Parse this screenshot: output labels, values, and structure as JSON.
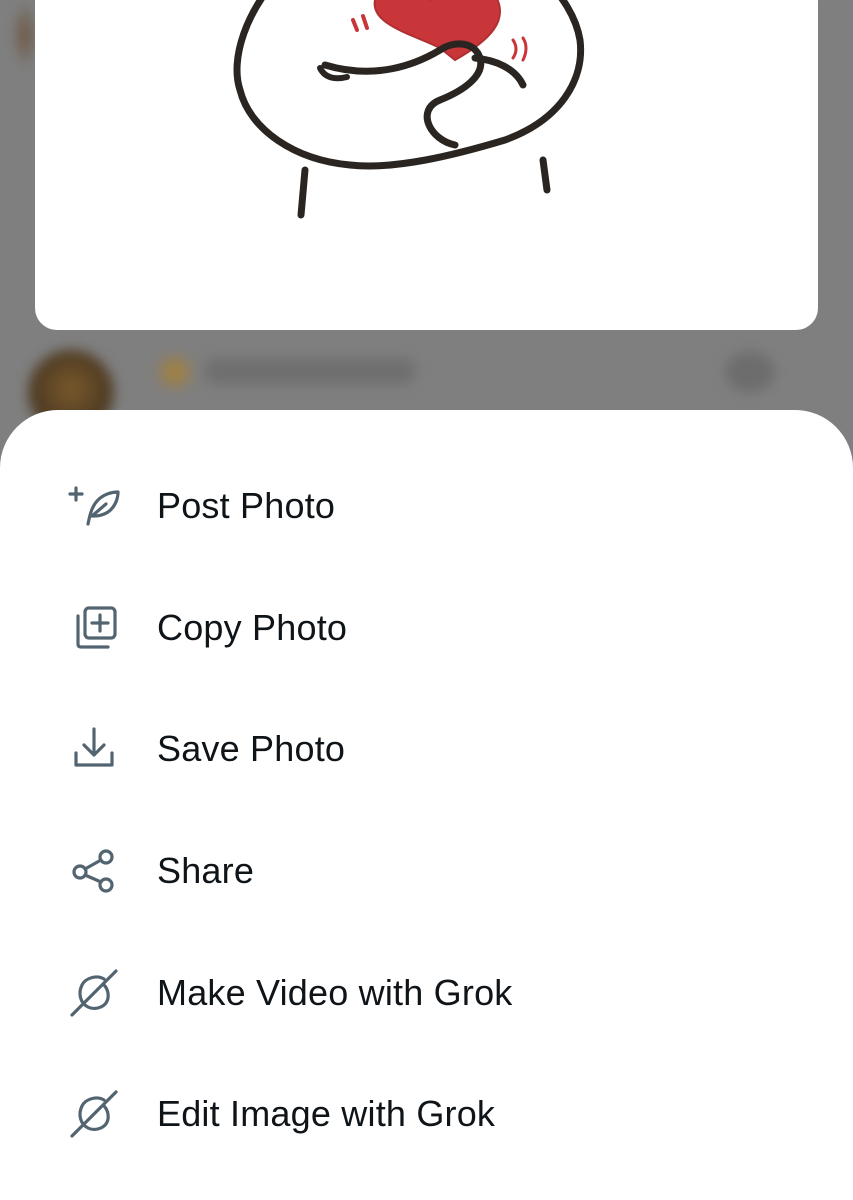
{
  "menu": {
    "items": [
      {
        "icon": "post-photo-icon",
        "label": "Post Photo"
      },
      {
        "icon": "copy-photo-icon",
        "label": "Copy Photo"
      },
      {
        "icon": "save-photo-icon",
        "label": "Save Photo"
      },
      {
        "icon": "share-icon",
        "label": "Share"
      },
      {
        "icon": "grok-icon",
        "label": "Make Video with Grok"
      },
      {
        "icon": "grok-icon",
        "label": "Edit Image with Grok"
      }
    ]
  },
  "colors": {
    "icon": "#536471",
    "text": "#0f1419",
    "heart": "#c8363a",
    "sheet": "#ffffff",
    "overlay": "#7f7f7f"
  }
}
